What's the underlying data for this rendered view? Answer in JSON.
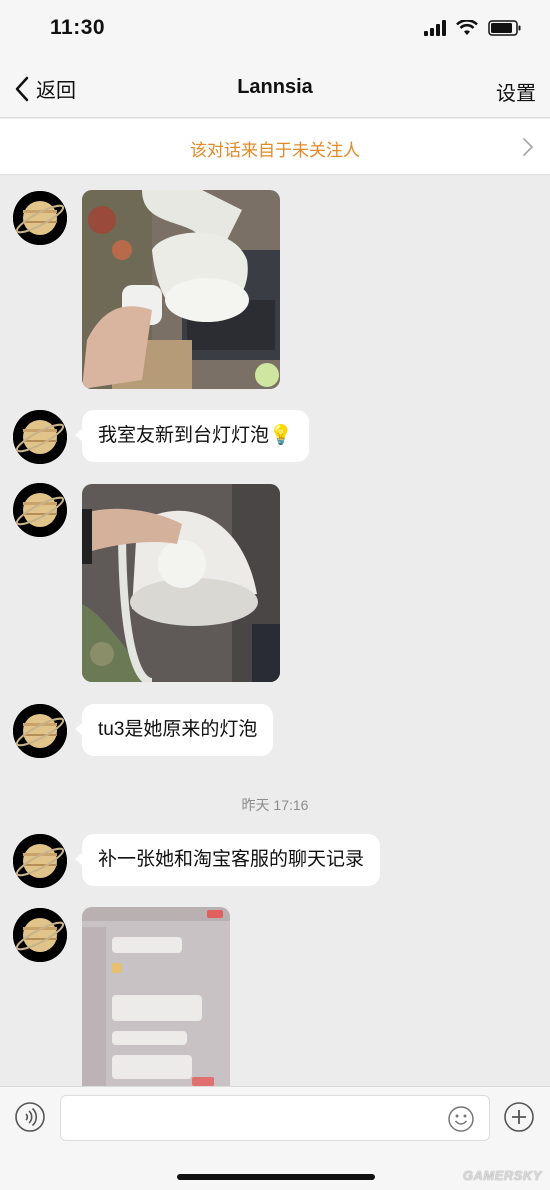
{
  "status_bar": {
    "time": "11:30"
  },
  "nav": {
    "back_label": "返回",
    "title": "Lannsia",
    "settings_label": "设置"
  },
  "notice": {
    "text": "该对话来自于未关注人"
  },
  "messages": [
    {
      "type": "image",
      "description_icon": "photo-desk-lamp-with-bulb"
    },
    {
      "type": "text",
      "text": "我室友新到台灯灯泡💡"
    },
    {
      "type": "image",
      "description_icon": "photo-bulb-in-lamp"
    },
    {
      "type": "text",
      "text": "tu3是她原来的灯泡"
    },
    {
      "type": "text",
      "text": "补一张她和淘宝客服的聊天记录"
    },
    {
      "type": "image",
      "description_icon": "photo-chat-screenshot"
    }
  ],
  "timestamp": "昨天 17:16",
  "input_bar": {
    "placeholder": ""
  },
  "watermark": "GAMERSKY",
  "colors": {
    "notice": "#e08a2a",
    "background": "#ececec",
    "bubble": "#ffffff"
  }
}
